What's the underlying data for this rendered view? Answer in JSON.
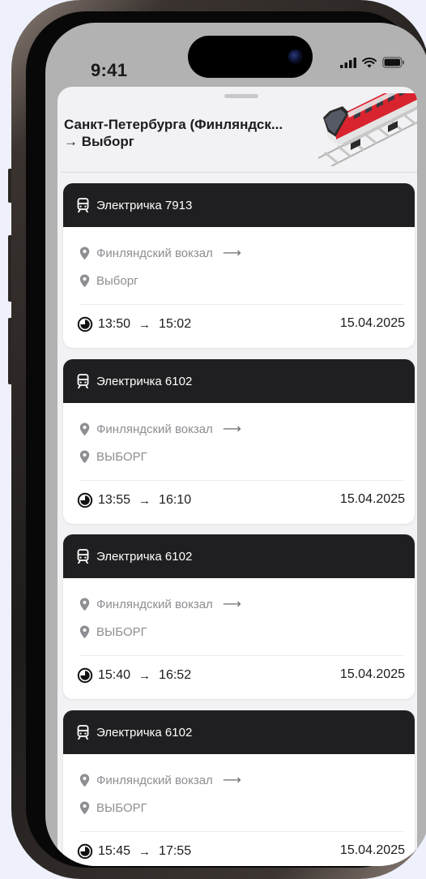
{
  "status_bar": {
    "time": "9:41"
  },
  "sheet": {
    "title_line1": "Санкт-Петербурга (Финляндск...",
    "title_line2": "→ Выборг"
  },
  "trips": [
    {
      "train": "Электричка 7913",
      "from": "Финляндский вокзал",
      "to": "Выборг",
      "dep": "13:50",
      "arr": "15:02",
      "date": "15.04.2025"
    },
    {
      "train": "Электричка 6102",
      "from": "Финляндский вокзал",
      "to": "ВЫБОРГ",
      "dep": "13:55",
      "arr": "16:10",
      "date": "15.04.2025"
    },
    {
      "train": "Электричка 6102",
      "from": "Финляндский вокзал",
      "to": "ВЫБОРГ",
      "dep": "15:40",
      "arr": "16:52",
      "date": "15.04.2025"
    },
    {
      "train": "Электричка 6102",
      "from": "Финляндский вокзал",
      "to": "ВЫБОРГ",
      "dep": "15:45",
      "arr": "17:55",
      "date": "15.04.2025"
    }
  ],
  "symbols": {
    "arrow": "→",
    "long_arrow": "⟶"
  },
  "colors": {
    "card_header": "#1f1f21",
    "train_accent": "#d9232e"
  },
  "icons": {
    "transport": "tram-icon",
    "location": "map-pin-icon",
    "time": "clock-icon"
  }
}
